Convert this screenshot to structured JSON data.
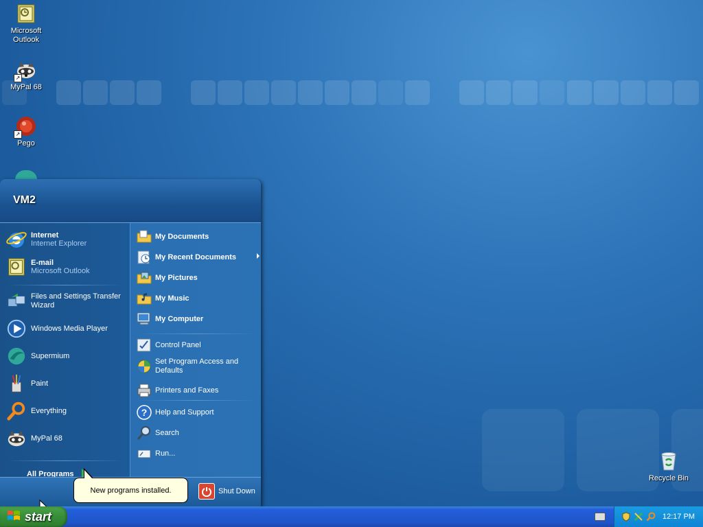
{
  "desktop": {
    "icons": [
      {
        "label": "Microsoft Outlook",
        "icon": "outlook-icon"
      },
      {
        "label": "MyPal 68",
        "icon": "mypal-icon"
      },
      {
        "label": "Pego",
        "icon": "pego-icon"
      },
      {
        "label": "Recycle Bin",
        "icon": "recycle-bin-icon"
      }
    ]
  },
  "start_menu": {
    "user": "VM2",
    "pinned": [
      {
        "title": "Internet",
        "subtitle": "Internet Explorer",
        "icon": "internet-explorer-icon"
      },
      {
        "title": "E-mail",
        "subtitle": "Microsoft Outlook",
        "icon": "outlook-icon"
      }
    ],
    "recent": [
      {
        "label": "Files and Settings Transfer Wizard",
        "icon": "transfer-wizard-icon"
      },
      {
        "label": "Windows Media Player",
        "icon": "media-player-icon"
      },
      {
        "label": "Supermium",
        "icon": "supermium-icon"
      },
      {
        "label": "Paint",
        "icon": "paint-icon"
      },
      {
        "label": "Everything",
        "icon": "everything-search-icon"
      },
      {
        "label": "MyPal 68",
        "icon": "mypal-icon"
      }
    ],
    "all_programs": "All Programs",
    "places": [
      {
        "label": "My Documents",
        "icon": "my-documents-icon"
      },
      {
        "label": "My Recent Documents",
        "icon": "recent-documents-icon"
      },
      {
        "label": "My Pictures",
        "icon": "my-pictures-icon"
      },
      {
        "label": "My Music",
        "icon": "my-music-icon"
      },
      {
        "label": "My Computer",
        "icon": "my-computer-icon"
      }
    ],
    "settings": [
      {
        "label": "Control Panel",
        "icon": "control-panel-icon"
      },
      {
        "label": "Set Program Access and Defaults",
        "icon": "program-defaults-icon"
      },
      {
        "label": "Printers and Faxes",
        "icon": "printer-icon"
      }
    ],
    "tools": [
      {
        "label": "Help and Support",
        "icon": "help-icon"
      },
      {
        "label": "Search",
        "icon": "search-icon"
      },
      {
        "label": "Run...",
        "icon": "run-icon"
      }
    ],
    "shutdown": "Shut Down"
  },
  "balloon": {
    "text": "New programs installed."
  },
  "taskbar": {
    "start_label": "start",
    "clock": "12:17 PM"
  }
}
